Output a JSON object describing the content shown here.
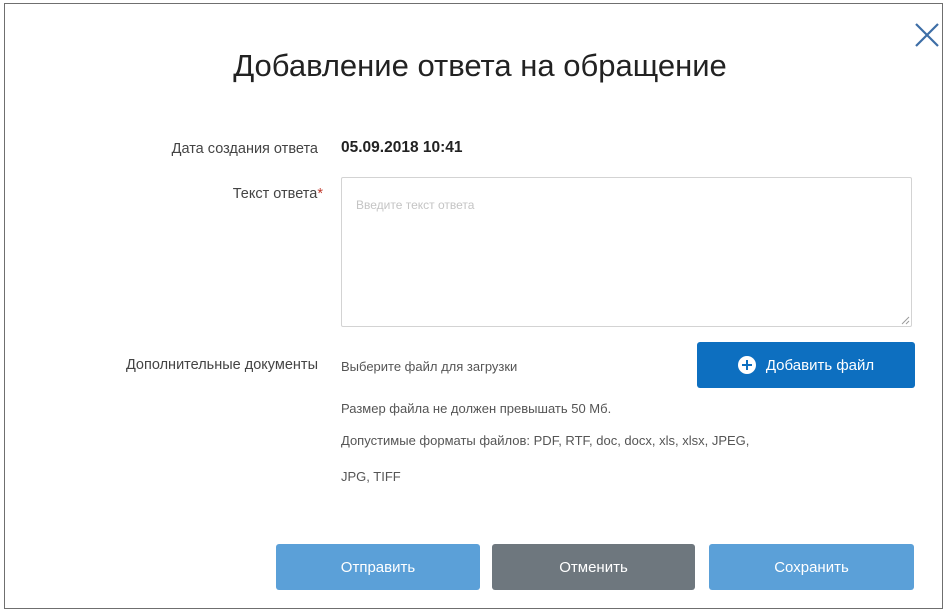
{
  "dialog": {
    "title": "Добавление ответа на обращение",
    "close_icon": "close-icon"
  },
  "form": {
    "date_label": "Дата создания ответа",
    "date_value": "05.09.2018 10:41",
    "text_label": "Текст ответа",
    "required_mark": "*",
    "text_value": "",
    "text_placeholder": "Введите текст ответа",
    "docs_label": "Дополнительные документы",
    "file_prompt": "Выберите файл для загрузки",
    "add_file_label": "Добавить файл",
    "add_file_icon": "plus-circle-icon",
    "size_note": "Размер файла не должен превышать 50 Мб.",
    "formats_note_line1": "Допустимые форматы файлов: PDF, RTF, doc, docx, xls, xlsx, JPEG,",
    "formats_note_line2": "JPG, TIFF"
  },
  "actions": {
    "send_label": "Отправить",
    "cancel_label": "Отменить",
    "save_label": "Сохранить"
  },
  "colors": {
    "primary": "#0d6fc0",
    "primary_light": "#5ba0d8",
    "secondary": "#6e777e",
    "required": "#c0392b"
  }
}
